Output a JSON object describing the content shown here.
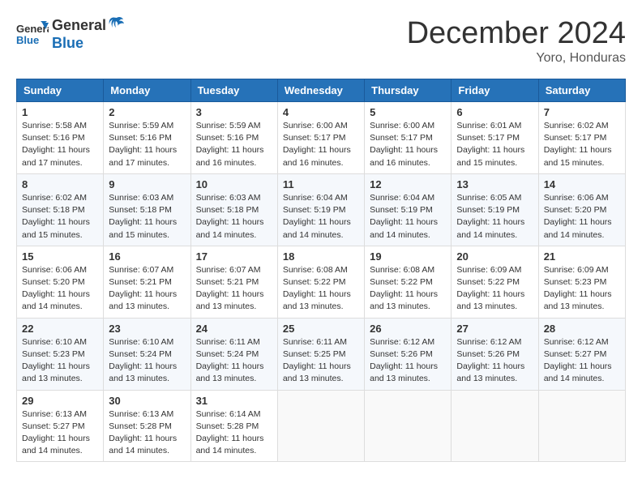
{
  "header": {
    "logo_general": "General",
    "logo_blue": "Blue",
    "title": "December 2024",
    "subtitle": "Yoro, Honduras"
  },
  "days_of_week": [
    "Sunday",
    "Monday",
    "Tuesday",
    "Wednesday",
    "Thursday",
    "Friday",
    "Saturday"
  ],
  "weeks": [
    [
      {
        "day": "1",
        "sunrise": "5:58 AM",
        "sunset": "5:16 PM",
        "daylight": "11 hours and 17 minutes."
      },
      {
        "day": "2",
        "sunrise": "5:59 AM",
        "sunset": "5:16 PM",
        "daylight": "11 hours and 17 minutes."
      },
      {
        "day": "3",
        "sunrise": "5:59 AM",
        "sunset": "5:16 PM",
        "daylight": "11 hours and 16 minutes."
      },
      {
        "day": "4",
        "sunrise": "6:00 AM",
        "sunset": "5:17 PM",
        "daylight": "11 hours and 16 minutes."
      },
      {
        "day": "5",
        "sunrise": "6:00 AM",
        "sunset": "5:17 PM",
        "daylight": "11 hours and 16 minutes."
      },
      {
        "day": "6",
        "sunrise": "6:01 AM",
        "sunset": "5:17 PM",
        "daylight": "11 hours and 15 minutes."
      },
      {
        "day": "7",
        "sunrise": "6:02 AM",
        "sunset": "5:17 PM",
        "daylight": "11 hours and 15 minutes."
      }
    ],
    [
      {
        "day": "8",
        "sunrise": "6:02 AM",
        "sunset": "5:18 PM",
        "daylight": "11 hours and 15 minutes."
      },
      {
        "day": "9",
        "sunrise": "6:03 AM",
        "sunset": "5:18 PM",
        "daylight": "11 hours and 15 minutes."
      },
      {
        "day": "10",
        "sunrise": "6:03 AM",
        "sunset": "5:18 PM",
        "daylight": "11 hours and 14 minutes."
      },
      {
        "day": "11",
        "sunrise": "6:04 AM",
        "sunset": "5:19 PM",
        "daylight": "11 hours and 14 minutes."
      },
      {
        "day": "12",
        "sunrise": "6:04 AM",
        "sunset": "5:19 PM",
        "daylight": "11 hours and 14 minutes."
      },
      {
        "day": "13",
        "sunrise": "6:05 AM",
        "sunset": "5:19 PM",
        "daylight": "11 hours and 14 minutes."
      },
      {
        "day": "14",
        "sunrise": "6:06 AM",
        "sunset": "5:20 PM",
        "daylight": "11 hours and 14 minutes."
      }
    ],
    [
      {
        "day": "15",
        "sunrise": "6:06 AM",
        "sunset": "5:20 PM",
        "daylight": "11 hours and 14 minutes."
      },
      {
        "day": "16",
        "sunrise": "6:07 AM",
        "sunset": "5:21 PM",
        "daylight": "11 hours and 13 minutes."
      },
      {
        "day": "17",
        "sunrise": "6:07 AM",
        "sunset": "5:21 PM",
        "daylight": "11 hours and 13 minutes."
      },
      {
        "day": "18",
        "sunrise": "6:08 AM",
        "sunset": "5:22 PM",
        "daylight": "11 hours and 13 minutes."
      },
      {
        "day": "19",
        "sunrise": "6:08 AM",
        "sunset": "5:22 PM",
        "daylight": "11 hours and 13 minutes."
      },
      {
        "day": "20",
        "sunrise": "6:09 AM",
        "sunset": "5:22 PM",
        "daylight": "11 hours and 13 minutes."
      },
      {
        "day": "21",
        "sunrise": "6:09 AM",
        "sunset": "5:23 PM",
        "daylight": "11 hours and 13 minutes."
      }
    ],
    [
      {
        "day": "22",
        "sunrise": "6:10 AM",
        "sunset": "5:23 PM",
        "daylight": "11 hours and 13 minutes."
      },
      {
        "day": "23",
        "sunrise": "6:10 AM",
        "sunset": "5:24 PM",
        "daylight": "11 hours and 13 minutes."
      },
      {
        "day": "24",
        "sunrise": "6:11 AM",
        "sunset": "5:24 PM",
        "daylight": "11 hours and 13 minutes."
      },
      {
        "day": "25",
        "sunrise": "6:11 AM",
        "sunset": "5:25 PM",
        "daylight": "11 hours and 13 minutes."
      },
      {
        "day": "26",
        "sunrise": "6:12 AM",
        "sunset": "5:26 PM",
        "daylight": "11 hours and 13 minutes."
      },
      {
        "day": "27",
        "sunrise": "6:12 AM",
        "sunset": "5:26 PM",
        "daylight": "11 hours and 13 minutes."
      },
      {
        "day": "28",
        "sunrise": "6:12 AM",
        "sunset": "5:27 PM",
        "daylight": "11 hours and 14 minutes."
      }
    ],
    [
      {
        "day": "29",
        "sunrise": "6:13 AM",
        "sunset": "5:27 PM",
        "daylight": "11 hours and 14 minutes."
      },
      {
        "day": "30",
        "sunrise": "6:13 AM",
        "sunset": "5:28 PM",
        "daylight": "11 hours and 14 minutes."
      },
      {
        "day": "31",
        "sunrise": "6:14 AM",
        "sunset": "5:28 PM",
        "daylight": "11 hours and 14 minutes."
      },
      null,
      null,
      null,
      null
    ]
  ],
  "labels": {
    "sunrise": "Sunrise:",
    "sunset": "Sunset:",
    "daylight": "Daylight:"
  }
}
